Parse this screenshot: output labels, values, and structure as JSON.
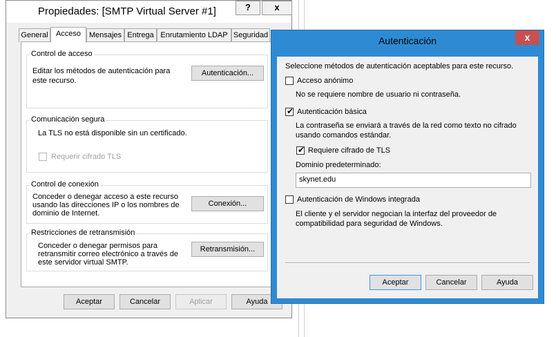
{
  "properties_window": {
    "title": "Propiedades: [SMTP Virtual Server #1]",
    "help_glyph": "?",
    "close_glyph": "x",
    "tabs": [
      "General",
      "Acceso",
      "Mensajes",
      "Entrega",
      "Enrutamiento LDAP",
      "Seguridad"
    ],
    "access_control": {
      "legend": "Control de acceso",
      "description": "Editar los métodos de autenticación para este recurso.",
      "button": "Autenticación..."
    },
    "secure_communication": {
      "legend": "Comunicación segura",
      "description": "La TLS no está disponible sin un certificado.",
      "require_tls_label": "Requerir cifrado TLS",
      "require_tls_checked": false,
      "require_tls_enabled": false
    },
    "connection_control": {
      "legend": "Control de conexión",
      "description": "Conceder o denegar acceso a este recurso usando las direcciones IP o los nombres de dominio de Internet.",
      "button": "Conexión..."
    },
    "relay_restrictions": {
      "legend": "Restricciones de retransmisión",
      "description": "Conceder o denegar permisos para retransmitir correo electrónico a través de este servidor virtual SMTP.",
      "button": "Retransmisión..."
    },
    "footer_buttons": {
      "ok": "Aceptar",
      "cancel": "Cancelar",
      "apply": "Aplicar",
      "help": "Ayuda"
    }
  },
  "auth_dialog": {
    "title": "Autenticación",
    "close_glyph": "x",
    "intro": "Seleccione métodos de autenticación aceptables para este recurso.",
    "anonymous": {
      "label": "Acceso anónimo",
      "checked": false,
      "description": "No se requiere nombre de usuario ni contraseña."
    },
    "basic": {
      "label": "Autenticación básica",
      "checked": true,
      "description": "La contraseña se enviará a través de la red como texto no cifrado usando comandos estándar.",
      "require_tls_label": "Requiere cifrado de TLS",
      "require_tls_checked": true,
      "default_domain_label": "Dominio predeterminado:",
      "default_domain_value": "skynet.edu"
    },
    "windows_integrated": {
      "label": "Autenticación de Windows integrada",
      "checked": false,
      "description": "El cliente y el servidor negocian la interfaz del proveedor de compatibilidad para seguridad de Windows."
    },
    "buttons": {
      "ok": "Aceptar",
      "cancel": "Cancelar",
      "help": "Ayuda"
    },
    "check_glyph": "✔"
  }
}
